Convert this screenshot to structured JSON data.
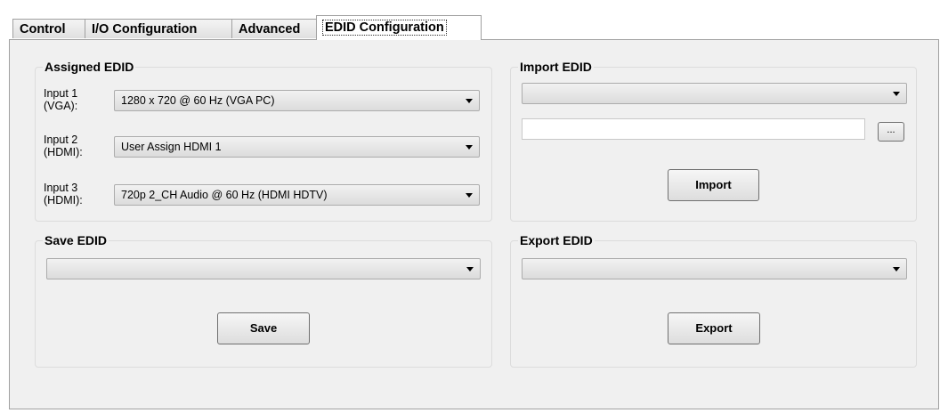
{
  "tabs": [
    "Control",
    "I/O Configuration",
    "Advanced",
    "EDID Configuration"
  ],
  "assigned": {
    "title": "Assigned EDID",
    "rows": [
      {
        "label_1": "Input 1",
        "label_2": "(VGA):",
        "value": "1280 x 720 @ 60 Hz (VGA PC)"
      },
      {
        "label_1": "Input 2",
        "label_2": "(HDMI):",
        "value": "User Assign HDMI 1"
      },
      {
        "label_1": "Input 3",
        "label_2": "(HDMI):",
        "value": "720p 2_CH Audio @ 60 Hz (HDMI HDTV)"
      }
    ]
  },
  "import": {
    "title": "Import EDID",
    "combo_value": "",
    "path_value": "",
    "browse_label": "...",
    "button_label": "Import"
  },
  "save": {
    "title": "Save EDID",
    "combo_value": "",
    "button_label": "Save"
  },
  "export": {
    "title": "Export EDID",
    "combo_value": "",
    "button_label": "Export"
  }
}
